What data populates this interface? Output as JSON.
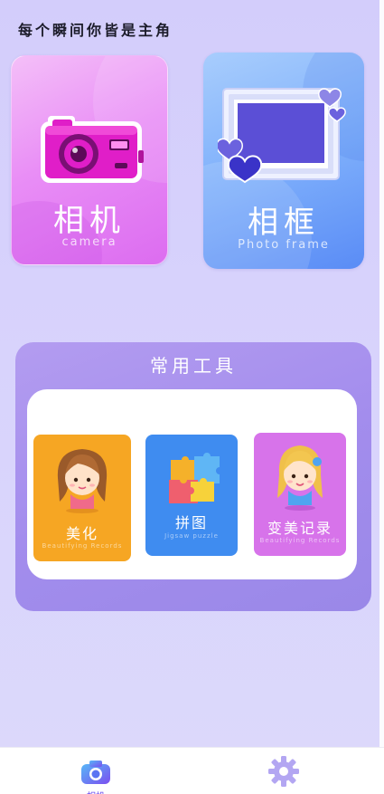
{
  "header": {
    "tagline": "每个瞬间你皆是主角"
  },
  "cards": {
    "camera": {
      "title": "相机",
      "subtitle": "camera"
    },
    "frame": {
      "title": "相框",
      "subtitle": "Photo frame"
    }
  },
  "tools": {
    "title": "常用工具",
    "items": [
      {
        "label": "美化",
        "sublabel": "Beautifying Records",
        "icon": "girl-avatar-icon"
      },
      {
        "label": "拼图",
        "sublabel": "Jigsaw puzzle",
        "icon": "puzzle-icon"
      },
      {
        "label": "变美记录",
        "sublabel": "Beautifying Records",
        "icon": "girl-avatar-icon"
      }
    ]
  },
  "nav": {
    "items": [
      {
        "label": "相机",
        "icon": "camera-icon",
        "active": true
      },
      {
        "label": "",
        "icon": "gear-icon",
        "active": false
      }
    ]
  },
  "colors": {
    "background": "#d3cdfb",
    "camera_card": "#e98ef6",
    "frame_card": "#7fb0fb",
    "tools_panel": "#a38ded",
    "tool_beautify": "#f6a623",
    "tool_puzzle": "#3f8cf0",
    "tool_record": "#d773ea",
    "accent": "#6a4df0"
  }
}
